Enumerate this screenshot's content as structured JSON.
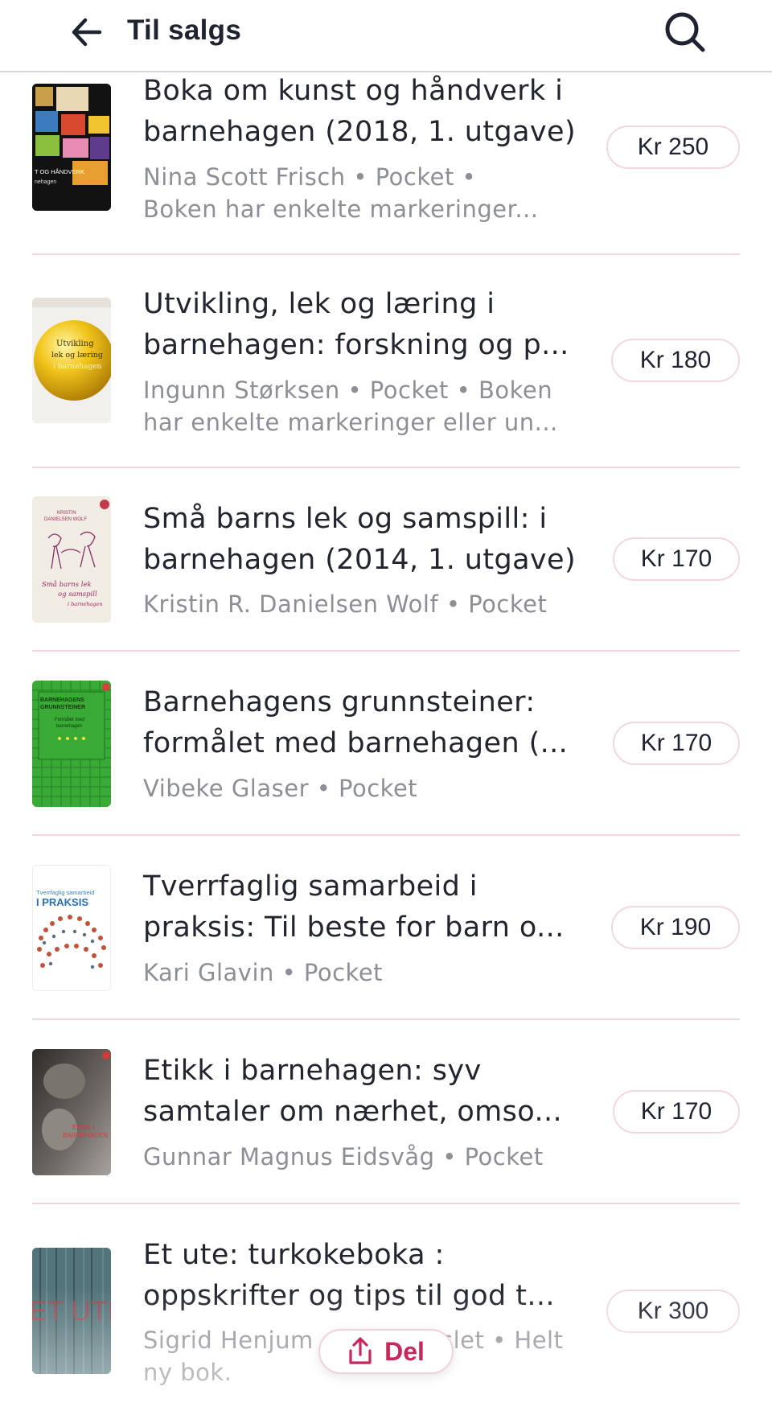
{
  "header": {
    "title": "Til salgs",
    "back_icon": "arrow-left-icon",
    "search_icon": "search-icon"
  },
  "listings": [
    {
      "title_lines": [
        "Boka om kunst og håndverk i",
        "barnehagen (2018, 1. utgave)"
      ],
      "meta_lines": [
        "Nina Scott Frisch • Pocket •",
        "Boken har enkelte markeringer..."
      ],
      "price": "Kr 250",
      "cover_text": [
        "T OG HÅNDVERK",
        "nehagen"
      ]
    },
    {
      "title_lines": [
        "Utvikling, lek og læring i",
        "barnehagen: forskning og p..."
      ],
      "meta_lines": [
        "Ingunn Størksen • Pocket • Boken",
        "har enkelte markeringer eller un..."
      ],
      "price": "Kr 180",
      "cover_text": [
        "Utvikling",
        "lek og læring",
        "i barnehagen"
      ]
    },
    {
      "title_lines": [
        "Små barns lek og samspill: i",
        "barnehagen (2014, 1. utgave)"
      ],
      "meta_lines": [
        "Kristin R. Danielsen Wolf • Pocket"
      ],
      "price": "Kr 170",
      "cover_text": [
        "KRISTIN",
        "DANIELSEN WOLF",
        "Små barns lek",
        "og samspill",
        "i barnehagen"
      ]
    },
    {
      "title_lines": [
        "Barnehagens grunnsteiner:",
        "formålet med barnehagen (..."
      ],
      "meta_lines": [
        "Vibeke Glaser • Pocket"
      ],
      "price": "Kr 170",
      "cover_text": [
        "BARNEHAGENS",
        "GRUNNSTEINER",
        "Formålet med",
        "barnehagen"
      ]
    },
    {
      "title_lines": [
        "Tverrfaglig samarbeid i",
        "praksis: Til beste for barn o..."
      ],
      "meta_lines": [
        "Kari Glavin • Pocket"
      ],
      "price": "Kr 190",
      "cover_text": [
        "Tverrfaglig samarbeid",
        "I PRAKSIS"
      ]
    },
    {
      "title_lines": [
        "Etikk i barnehagen: syv",
        "samtaler om nærhet, omso..."
      ],
      "meta_lines": [
        "Gunnar Magnus Eidsvåg • Pocket"
      ],
      "price": "Kr 170",
      "cover_text": [
        "ETIKK I",
        "BARNEHAGEN"
      ]
    },
    {
      "title_lines": [
        "Et ute: turkokeboka :",
        "oppskrifter og tips til god t..."
      ],
      "meta_lines": [
        "Sigrid Henjum og Lena Aslet • Helt",
        "ny bok."
      ],
      "price": "Kr 300",
      "cover_text": [
        "ET UTE"
      ]
    }
  ],
  "share_button": {
    "label": "Del",
    "icon": "share-icon"
  },
  "colors": {
    "accent": "#c7285c",
    "divider": "#f2d5de",
    "pill_border": "#f2d7df",
    "secondary_text": "#8d8f96",
    "primary_text": "#22252e"
  }
}
